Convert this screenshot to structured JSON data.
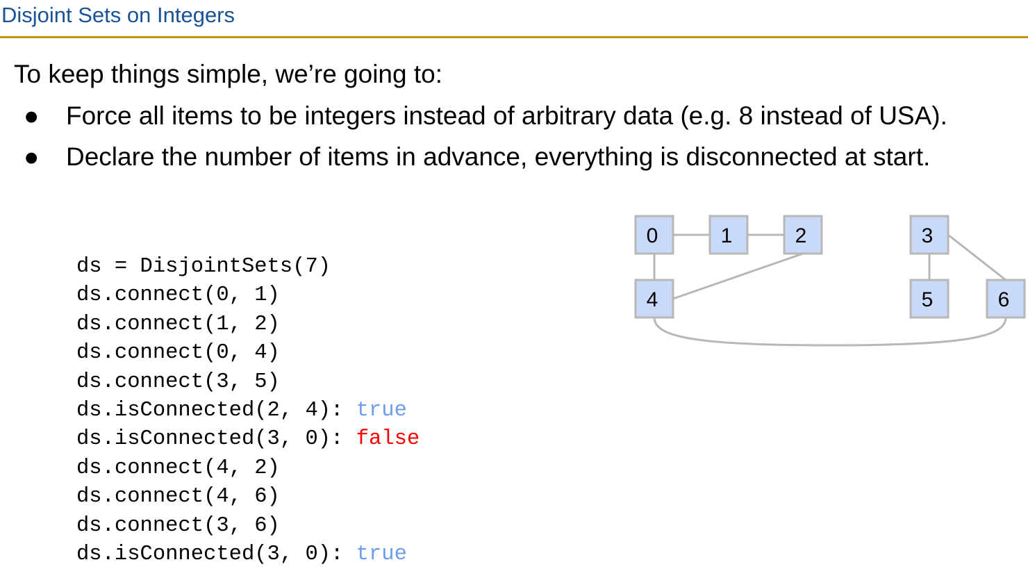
{
  "title": "Disjoint Sets on Integers",
  "intro": "To keep things simple, we’re going to:",
  "bullets": [
    "Force all items to be integers instead of arbitrary data (e.g. 8 instead of USA).",
    "Declare the number of items in advance, everything is disconnected at start."
  ],
  "bullet_glyph": "●",
  "code": [
    {
      "text": "ds = DisjointSets(7)",
      "result": ""
    },
    {
      "text": "ds.connect(0, 1)",
      "result": ""
    },
    {
      "text": "ds.connect(1, 2)",
      "result": ""
    },
    {
      "text": "ds.connect(0, 4)",
      "result": ""
    },
    {
      "text": "ds.connect(3, 5)",
      "result": ""
    },
    {
      "text": "ds.isConnected(2, 4): ",
      "result": "true"
    },
    {
      "text": "ds.isConnected(3, 0): ",
      "result": "false"
    },
    {
      "text": "ds.connect(4, 2)",
      "result": ""
    },
    {
      "text": "ds.connect(4, 6)",
      "result": ""
    },
    {
      "text": "ds.connect(3, 6)",
      "result": ""
    },
    {
      "text": "ds.isConnected(3, 0): ",
      "result": "true"
    }
  ],
  "colors": {
    "title": "#1a5296",
    "rule": "#bf9000",
    "true": "#6d9eeb",
    "false": "#ff0000",
    "node_fill": "#c9daf8",
    "node_border": "#b7b7b7",
    "edge": "#b7b7b7"
  },
  "graph": {
    "nodes": [
      "0",
      "1",
      "2",
      "3",
      "4",
      "5",
      "6"
    ],
    "edges": [
      [
        "0",
        "1"
      ],
      [
        "1",
        "2"
      ],
      [
        "0",
        "4"
      ],
      [
        "3",
        "5"
      ],
      [
        "4",
        "2"
      ],
      [
        "4",
        "6"
      ],
      [
        "3",
        "6"
      ]
    ]
  }
}
